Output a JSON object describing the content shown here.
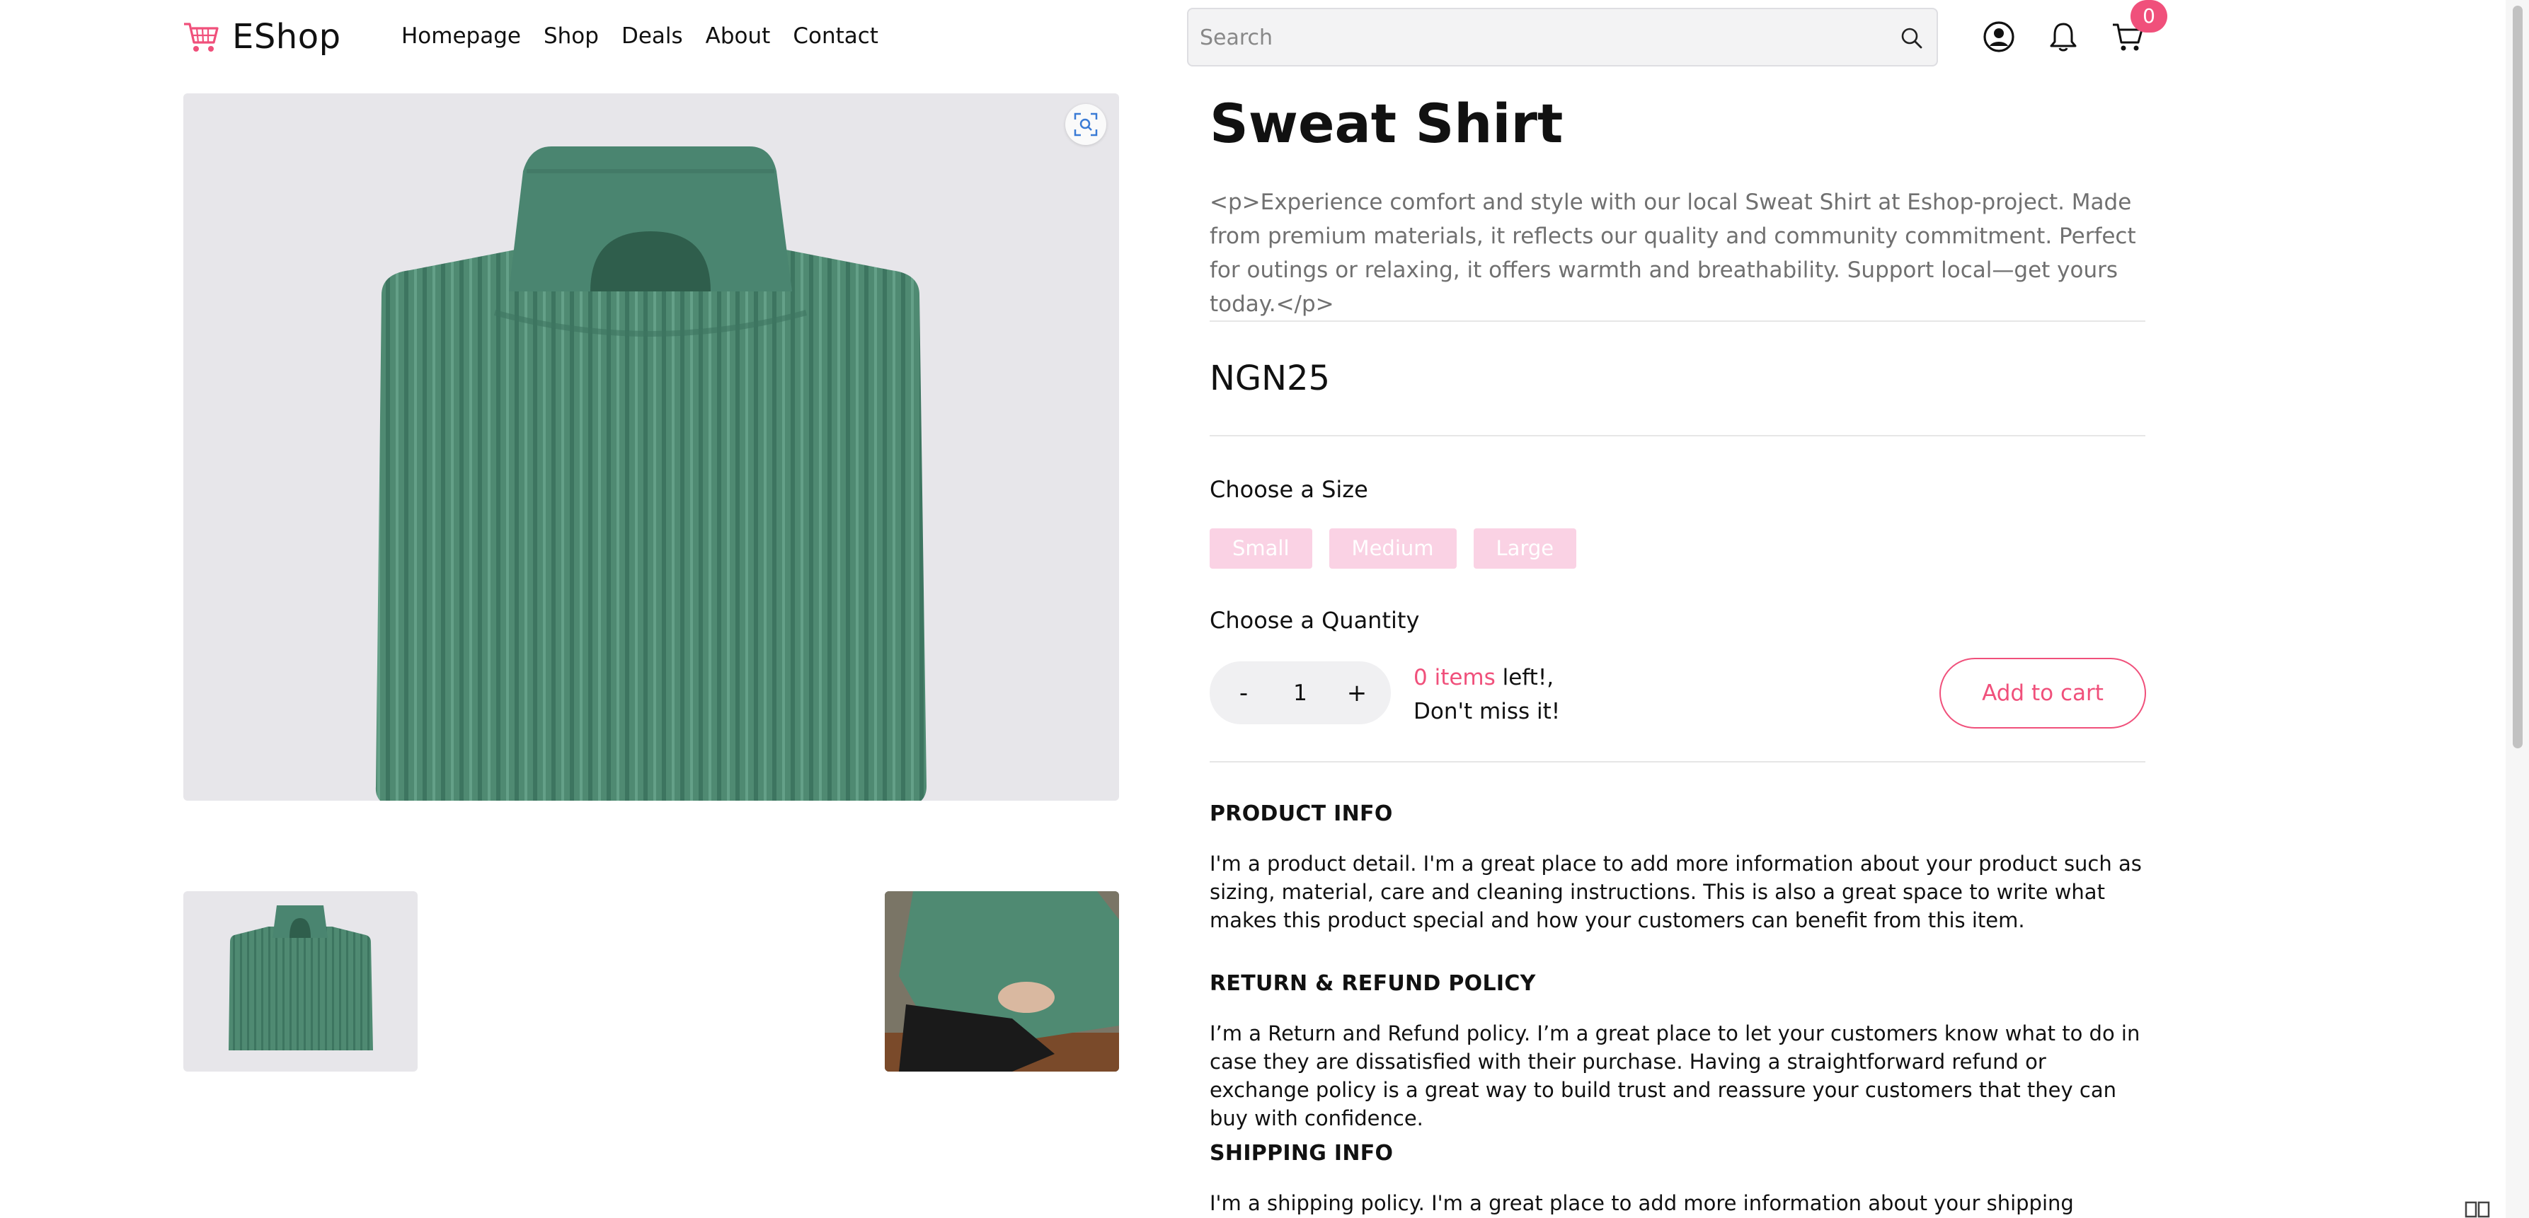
{
  "header": {
    "brand": "EShop",
    "nav": [
      "Homepage",
      "Shop",
      "Deals",
      "About",
      "Contact"
    ],
    "search_placeholder": "Search",
    "cart_count": "0"
  },
  "product": {
    "title": "Sweat Shirt",
    "description": "<p>Experience comfort and style with our local Sweat Shirt at Eshop-project. Made from premium materials, it reflects our quality and community commitment. Perfect for outings or relaxing, it offers warmth and breathability. Support local—get yours today.</p>",
    "price": "NGN25",
    "size_label": "Choose a Size",
    "sizes": [
      "Small",
      "Medium",
      "Large"
    ],
    "quantity_label": "Choose a Quantity",
    "quantity": "1",
    "decrement": "-",
    "increment": "+",
    "stock_count": "0 items",
    "stock_suffix": " left!,",
    "stock_line2": "Don't miss it!",
    "add_to_cart": "Add to cart"
  },
  "sections": [
    {
      "title": "PRODUCT INFO",
      "text": "I'm a product detail. I'm a great place to add more information about your product such as sizing, material, care and cleaning instructions. This is also a great space to write what makes this product special and how your customers can benefit from this item."
    },
    {
      "title": "RETURN & REFUND POLICY",
      "text": "I’m a Return and Refund policy. I’m a great place to let your customers know what to do in case they are dissatisfied with their purchase. Having a straightforward refund or exchange policy is a great way to build trust and reassure your customers that they can buy with confidence."
    },
    {
      "title": "SHIPPING INFO",
      "text": "I'm a shipping policy. I'm a great place to add more information about your shipping methods,"
    }
  ],
  "colors": {
    "accent": "#f0507b",
    "size_button_bg": "#fad2e4",
    "sweater": "#4f8a72",
    "image_bg": "#e7e6ea"
  },
  "icons": [
    "cart-logo-icon",
    "search-icon",
    "user-icon",
    "bell-icon",
    "cart-icon",
    "zoom-icon",
    "reader-icon"
  ]
}
